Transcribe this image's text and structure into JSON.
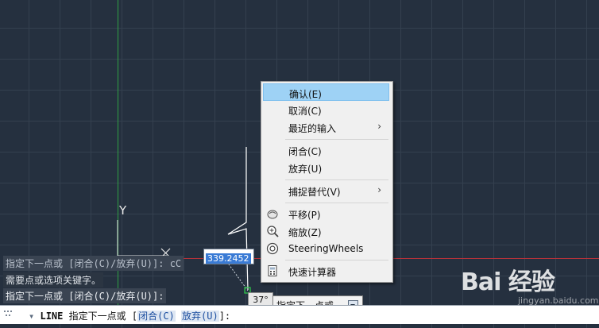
{
  "history": {
    "line1": "指定下一点或 [闭合(C)/放弃(U)]: cC",
    "line2": "需要点或选项关键字。",
    "line3": "指定下一点或 [闭合(C)/放弃(U)]:"
  },
  "dynamic_input": {
    "value": "339.2452"
  },
  "angle_tooltip": {
    "value": "37°"
  },
  "prompt_tooltip": {
    "text": "指定下一点或"
  },
  "command_line": {
    "command": "LINE",
    "prompt": "指定下一点或",
    "open_bracket": "[",
    "option1": "闭合(C)",
    "option2": "放弃(U)",
    "close": "]:"
  },
  "ucs": {
    "y_label": "Y"
  },
  "context_menu": {
    "items": [
      {
        "label": "确认(E)"
      },
      {
        "label": "取消(C)"
      },
      {
        "label": "最近的输入"
      },
      {
        "label": "闭合(C)"
      },
      {
        "label": "放弃(U)"
      },
      {
        "label": "捕捉替代(V)"
      },
      {
        "label": "平移(P)",
        "icon": "pan-hand-icon"
      },
      {
        "label": "缩放(Z)",
        "icon": "zoom-magnifier-icon"
      },
      {
        "label": "SteeringWheels",
        "icon": "steering-wheel-icon"
      },
      {
        "label": "快速计算器",
        "icon": "calculator-icon"
      }
    ],
    "highlighted": "确认(E)"
  },
  "watermark": {
    "brand": "Bai 经验",
    "url": "jingyan.baidu.com"
  },
  "colors": {
    "background": "#25303f",
    "grid": "#34404f",
    "y_axis": "#2fa043",
    "x_axis": "#b5323a",
    "drawing": "#ffffff",
    "menu_highlight": "#9ed2f5"
  }
}
